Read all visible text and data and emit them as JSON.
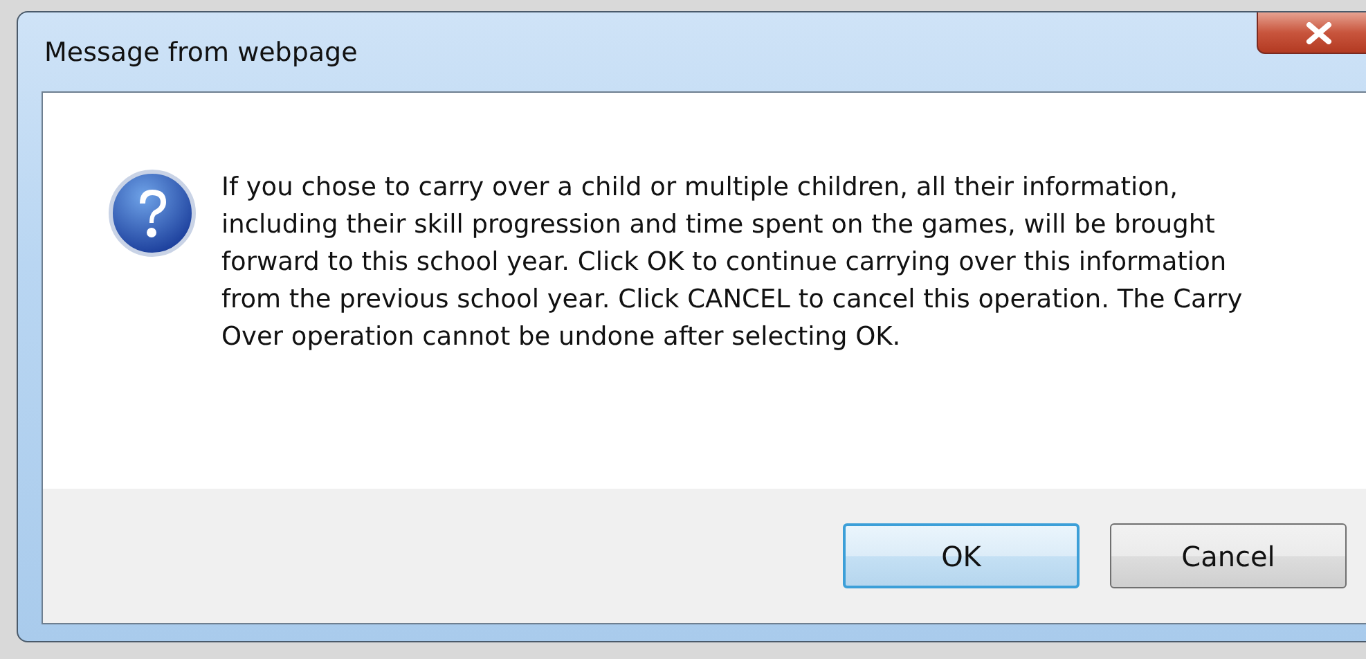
{
  "window": {
    "title": "Message from webpage"
  },
  "message": "If you chose to carry over a child or multiple children, all their information, including their skill progression and time spent on the games, will be brought forward to this school year. Click OK to continue carrying over this information from the previous school year. Click CANCEL to cancel this operation. The Carry Over operation cannot be undone after selecting OK.",
  "buttons": [
    {
      "label": "OK",
      "default": true
    },
    {
      "label": "Cancel",
      "default": false
    }
  ]
}
